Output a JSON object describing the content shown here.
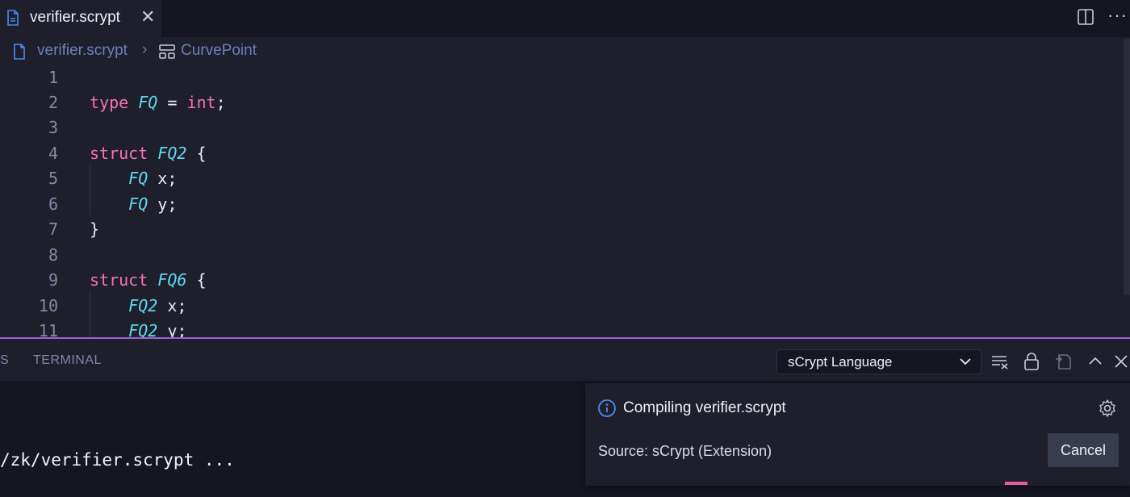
{
  "tab": {
    "title": "verifier.scrypt"
  },
  "breadcrumb": {
    "file": "verifier.scrypt",
    "separator": "›",
    "symbol": "CurvePoint"
  },
  "editor": {
    "lines": [
      {
        "num": "1"
      },
      {
        "num": "2",
        "kw": "type",
        "ty": "FQ",
        "rest": " = ",
        "kw2": "int",
        "rest2": ";"
      },
      {
        "num": "3"
      },
      {
        "num": "4",
        "kw": "struct",
        "ty": "FQ2",
        "rest": " {"
      },
      {
        "num": "5",
        "ty": "FQ",
        "rest": " x;"
      },
      {
        "num": "6",
        "ty": "FQ",
        "rest": " y;"
      },
      {
        "num": "7",
        "rest": "}"
      },
      {
        "num": "8"
      },
      {
        "num": "9",
        "kw": "struct",
        "ty": "FQ6",
        "rest": " {"
      },
      {
        "num": "10",
        "ty": "FQ2",
        "rest": " x;"
      },
      {
        "num": "11",
        "ty": "FQ2",
        "rest": " y;"
      }
    ]
  },
  "panel": {
    "tab_partial": "S",
    "tab_terminal": "TERMINAL",
    "output_channel": "sCrypt Language",
    "terminal_line": "/zk/verifier.scrypt ..."
  },
  "notification": {
    "message": "Compiling verifier.scrypt",
    "source": "Source: sCrypt (Extension)",
    "cancel_label": "Cancel"
  },
  "colors": {
    "keyword": "#f472b6",
    "type": "#5fd8f0",
    "accent": "#a061e0",
    "progress": "#e85aa5"
  }
}
